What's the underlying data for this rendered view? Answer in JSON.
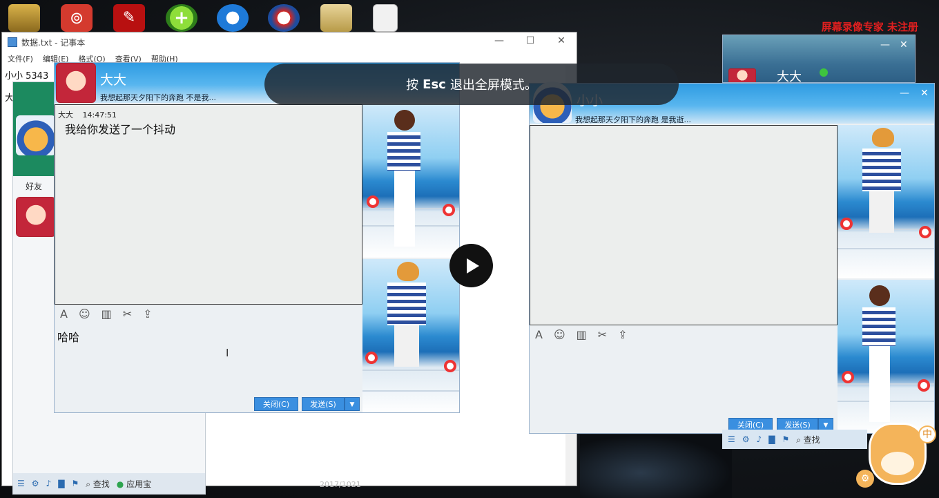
{
  "watermark": "屏幕录像专家  未注册",
  "fullscreen_toast": {
    "prefix": "按",
    "key": "Esc",
    "suffix": "退出全屏模式。"
  },
  "notepad": {
    "title": "数据.txt - 记事本",
    "menus": [
      "文件(F)",
      "编辑(E)",
      "格式(O)",
      "查看(V)",
      "帮助(H)"
    ],
    "lines": [
      "小小 5343",
      "大"
    ],
    "taskbar_text": "2017/1021"
  },
  "qq_list": {
    "group_label": "好友",
    "bottom_search": "查找",
    "bottom_app": "应用宝"
  },
  "chat_left": {
    "name": "大大",
    "signature": "我想起那天夕阳下的奔跑  不是我...",
    "message_sender": "大大",
    "message_time": "14:47:51",
    "message_text": "我给你发送了一个抖动",
    "input_text": "哈哈",
    "close_label": "关闭(C)",
    "send_label": "发送(S)"
  },
  "chat_right_back": {
    "name": "大大"
  },
  "chat_right": {
    "name": "小小",
    "signature": "我想起那天夕阳下的奔跑  是我逝...",
    "close_label": "关闭(C)",
    "send_label": "发送(S)"
  },
  "qq_bar_right": {
    "search_label": "查找"
  },
  "ime": {
    "lang": "中"
  },
  "colors": {
    "qq_blue": "#2e9be2",
    "send_button": "#3a8fe0",
    "watermark_red": "#e01f1f"
  },
  "icons": {
    "toolbar": [
      "font-icon",
      "emoji-icon",
      "shake-icon",
      "scissors-icon",
      "upload-icon"
    ],
    "bottom": [
      "menu-icon",
      "gear-icon",
      "speaker-icon",
      "folder-icon",
      "bookmark-icon",
      "search-icon"
    ]
  }
}
